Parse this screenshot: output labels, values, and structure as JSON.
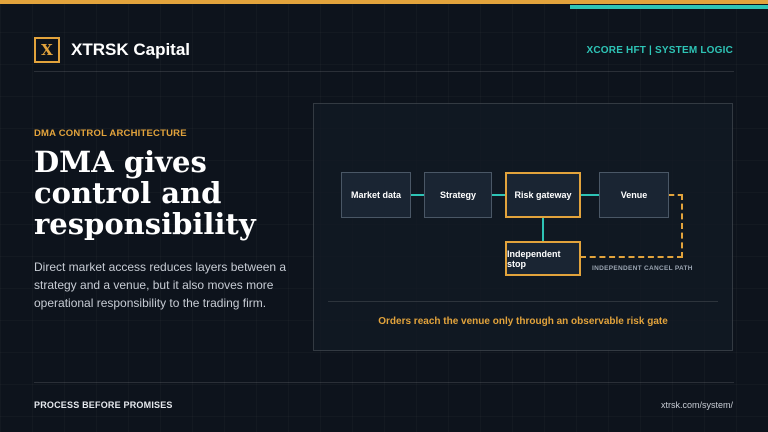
{
  "header": {
    "logo_letter": "X",
    "brand": "XTRSK Capital",
    "tag": "XCORE HFT | SYSTEM LOGIC"
  },
  "content": {
    "eyebrow": "DMA CONTROL ARCHITECTURE",
    "headline": "DMA gives control and responsibility",
    "body": "Direct market access reduces layers between a strategy and a venue, but it also moves more operational responsibility to the trading firm."
  },
  "diagram": {
    "nodes": {
      "market_data": "Market data",
      "strategy": "Strategy",
      "risk_gateway": "Risk gateway",
      "venue": "Venue",
      "independent_stop": "Independent stop"
    },
    "cancel_path_label": "INDEPENDENT CANCEL PATH",
    "caption": "Orders reach the venue only through an observable risk gate"
  },
  "footer": {
    "left": "PROCESS BEFORE PROMISES",
    "right": "xtrsk.com/system/"
  },
  "colors": {
    "accent_gold": "#e2a33c",
    "accent_teal": "#2ec4b6",
    "background": "#0d131c"
  }
}
